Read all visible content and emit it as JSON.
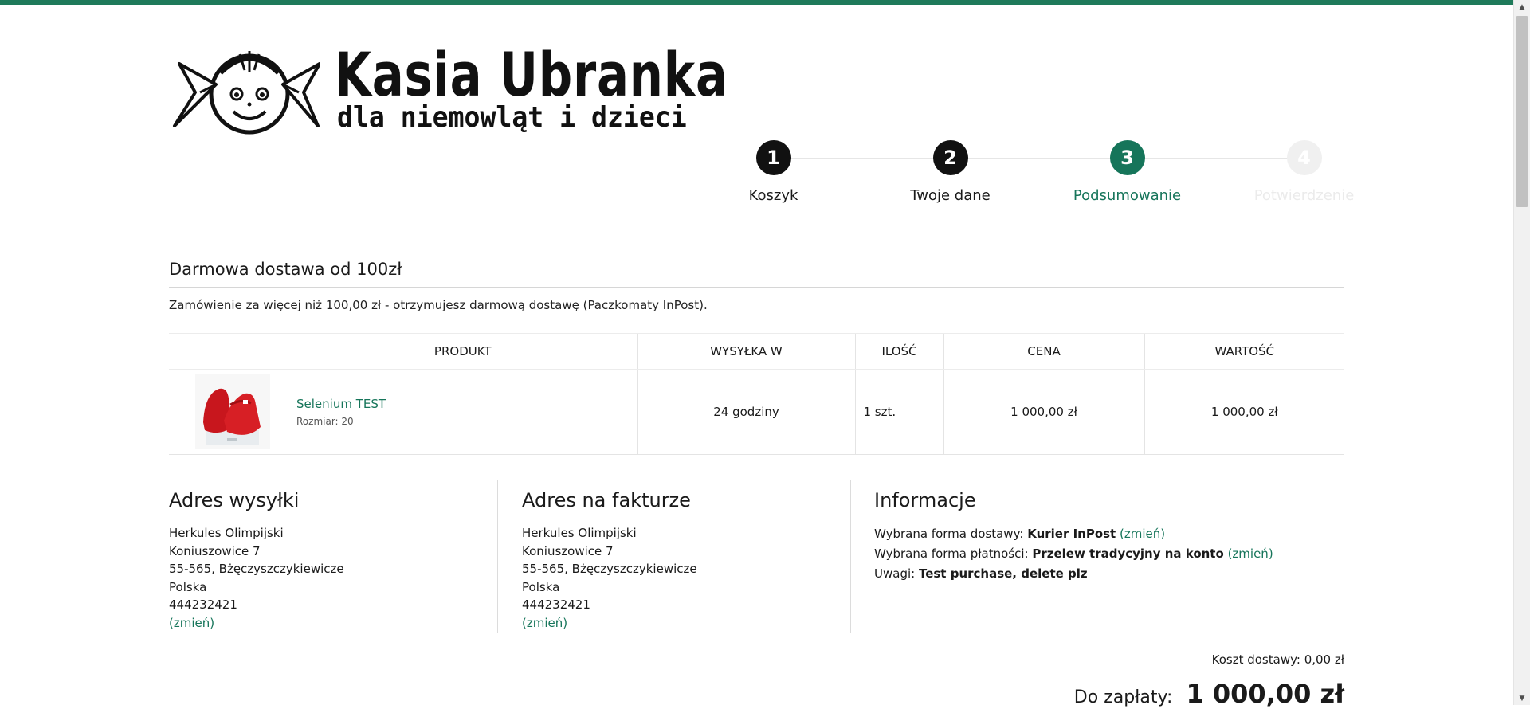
{
  "brand": {
    "title": "Kasia Ubranka",
    "subtitle": "dla niemowląt i dzieci"
  },
  "steps": [
    {
      "number": "1",
      "label": "Koszyk",
      "state": "done"
    },
    {
      "number": "2",
      "label": "Twoje dane",
      "state": "done"
    },
    {
      "number": "3",
      "label": "Podsumowanie",
      "state": "active"
    },
    {
      "number": "4",
      "label": "Potwierdzenie",
      "state": "todo"
    }
  ],
  "notice": {
    "title": "Darmowa dostawa od 100zł",
    "text": "Zamówienie za więcej niż 100,00 zł - otrzymujesz darmową dostawę (Paczkomaty InPost)."
  },
  "table": {
    "headers": [
      "PRODUKT",
      "WYSYŁKA W",
      "ILOŚĆ",
      "CENA",
      "WARTOŚĆ"
    ],
    "rows": [
      {
        "name": "Selenium TEST",
        "attribute": "Rozmiar: 20",
        "shipping": "24 godziny",
        "quantity": "1 szt.",
        "price": "1 000,00 zł",
        "value": "1 000,00 zł"
      }
    ]
  },
  "shipping_address": {
    "title": "Adres wysyłki",
    "lines": [
      "Herkules Olimpijski",
      "Koniuszowice 7",
      "55-565, Bżęczyszczykiewicze",
      "Polska",
      "444232421"
    ],
    "change": "(zmień)"
  },
  "billing_address": {
    "title": "Adres na fakturze",
    "lines": [
      "Herkules Olimpijski",
      "Koniuszowice 7",
      "55-565, Bżęczyszczykiewicze",
      "Polska",
      "444232421"
    ],
    "change": "(zmień)"
  },
  "info": {
    "title": "Informacje",
    "delivery_label": "Wybrana forma dostawy:",
    "delivery_value": "Kurier InPost",
    "payment_label": "Wybrana forma płatności:",
    "payment_value": "Przelew tradycyjny na konto",
    "notes_label": "Uwagi:",
    "notes_value": "Test purchase, delete plz",
    "change": "(zmień)"
  },
  "summary": {
    "shipping_cost": "Koszt dostawy: 0,00 zł",
    "total_label": "Do zapłaty:",
    "total_value": "1 000,00 zł"
  },
  "colors": {
    "accent": "#16755a",
    "topbar": "#1f7a5a",
    "step_done": "#111111",
    "step_todo": "#f0f0f0"
  }
}
